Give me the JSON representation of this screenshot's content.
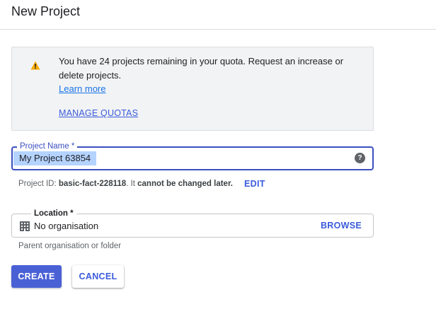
{
  "header": {
    "title": "New Project"
  },
  "quota_notice": {
    "icon": "warning-icon",
    "message": "You have 24 projects remaining in your quota. Request an increase or delete projects.",
    "learn_more": "Learn more",
    "manage_quotas": "MANAGE QUOTAS"
  },
  "project_name": {
    "label": "Project Name *",
    "value": "My Project 63854",
    "help_icon": "help-icon"
  },
  "project_id": {
    "prefix": "Project ID: ",
    "id": "basic-fact-228118",
    "middle": ". It ",
    "warning": "cannot be changed later.",
    "edit": "EDIT"
  },
  "location": {
    "label": "Location *",
    "icon": "building-icon",
    "value": "No organisation",
    "browse": "BROWSE",
    "hint": "Parent organisation or folder"
  },
  "actions": {
    "create": "CREATE",
    "cancel": "CANCEL"
  },
  "colors": {
    "accent": "#3b5bdb",
    "primary_button": "#4a61d6",
    "warning": "#f9ab00"
  }
}
